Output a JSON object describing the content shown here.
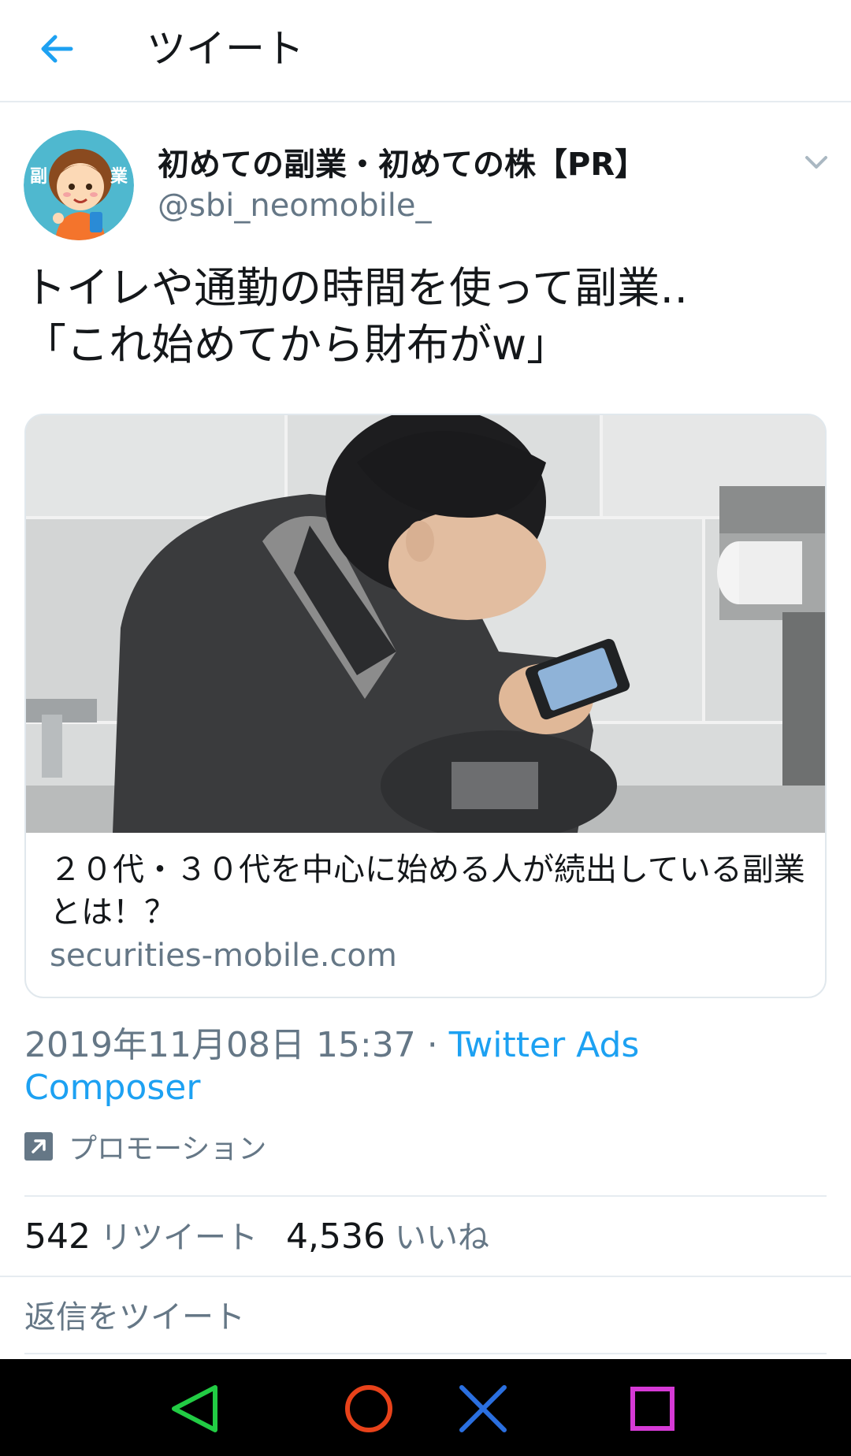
{
  "header": {
    "title": "ツイート",
    "back_icon": "arrow-left-icon",
    "accent_color": "#1da1f2"
  },
  "tweet": {
    "author_name": "初めての副業・初めての株【PR】",
    "author_handle": "@sbi_neomobile_",
    "avatar_text_left": "副",
    "avatar_text_right": "業",
    "text_line1": "トイレや通勤の時間を使って副業‥",
    "text_line2": "「これ始めてから財布がw」",
    "menu_icon": "chevron-down-icon"
  },
  "card": {
    "image_description_icon": "photo",
    "title": "２０代・３０代を中心に始める人が続出している副業とは！？",
    "domain": "securities-mobile.com"
  },
  "meta": {
    "timestamp": "2019年11月08日 15:37",
    "separator": " · ",
    "source": "Twitter Ads Composer"
  },
  "promo": {
    "icon": "promoted-arrow-icon",
    "label": "プロモーション"
  },
  "stats": {
    "retweets_count": "542",
    "retweets_label": "リツイート",
    "likes_count": "4,536",
    "likes_label": "いいね"
  },
  "reply": {
    "placeholder": "返信をツイート"
  },
  "navbar": {
    "buttons": [
      "triangle-back-icon",
      "circle-home-icon",
      "cross-icon",
      "square-recents-icon"
    ],
    "colors": {
      "triangle": "#22cc44",
      "circle": "#e8421a",
      "cross": "#2a6fe0",
      "square": "#d63ad6"
    }
  }
}
